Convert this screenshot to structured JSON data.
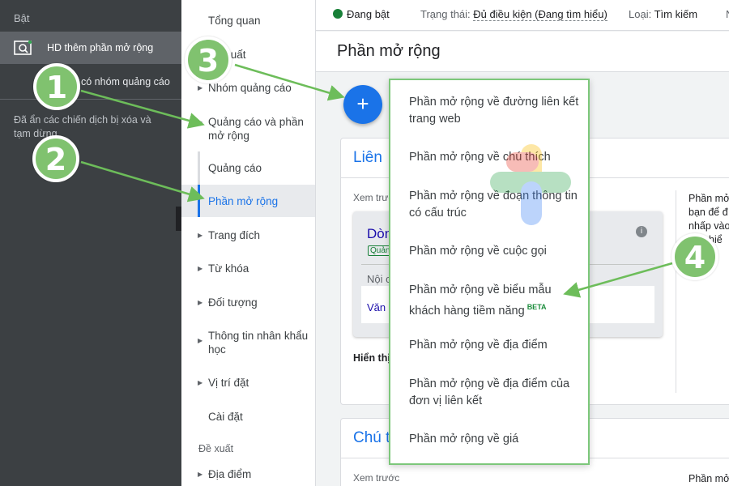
{
  "left_panel": {
    "section_label": "Bật",
    "active_item": "HD thêm phần mở rộng",
    "sub_item": "có nhóm quảng cáo",
    "note": "Đã ẩn các chiến dịch bị xóa và tạm dừng"
  },
  "nav": {
    "items": [
      {
        "label": "Tổng quan"
      },
      {
        "label": "Đề xuất"
      },
      {
        "label": "Nhóm quảng cáo"
      },
      {
        "label": "Quảng cáo và phần mở rộng"
      },
      {
        "label": "Quảng cáo"
      },
      {
        "label": "Phần mở rộng"
      },
      {
        "label": "Trang đích"
      },
      {
        "label": "Từ khóa"
      },
      {
        "label": "Đối tượng"
      },
      {
        "label": "Thông tin nhân khẩu học"
      },
      {
        "label": "Vị trí đặt"
      },
      {
        "label": "Cài đặt"
      },
      {
        "label": "Địa điểm"
      }
    ],
    "section": "Đề xuất"
  },
  "topbar": {
    "status_on": "Đang bật",
    "status_label": "Trạng thái:",
    "status_value": "Đủ điều kiện (Đang tìm hiểu)",
    "type_label": "Loại:",
    "type_value": "Tìm kiếm",
    "more": "N"
  },
  "page_title": "Phần mở rộng",
  "fab_label": "+",
  "card1": {
    "title": "Liên",
    "preview_label": "Xem trướ",
    "right_note": "Phần mở bạn để đ nhấp vào Tìm hiể",
    "ad_head": "Dòn",
    "ad_badge": "Quản",
    "ad_desc": "Nội c",
    "ad_link": "Văn",
    "caption": "Hiển thị ... ng web của bạn"
  },
  "card2": {
    "title": "Chú t",
    "preview_label": "Xem trước",
    "right_note": "Phần mở"
  },
  "menu": {
    "items": [
      {
        "label": "Phần mở rộng về đường liên kết trang web"
      },
      {
        "label": "Phần mở rộng về chú thích"
      },
      {
        "label": "Phần mở rộng về đoạn thông tin có cấu trúc"
      },
      {
        "label": "Phần mở rộng về cuộc gọi"
      },
      {
        "label": "Phần mở rộng về biểu mẫu khách hàng tiềm năng",
        "badge": "BETA"
      },
      {
        "label": "Phần mở rộng về địa điểm"
      },
      {
        "label": "Phần mở rộng về địa điểm của đơn vị liên kết"
      },
      {
        "label": "Phần mở rộng về giá"
      }
    ]
  },
  "callouts": [
    "1",
    "2",
    "3",
    "4"
  ],
  "colors": {
    "accent": "#1a73e8",
    "callout": "#80c26f",
    "sidebar": "#3c4043",
    "status_green": "#188038"
  }
}
